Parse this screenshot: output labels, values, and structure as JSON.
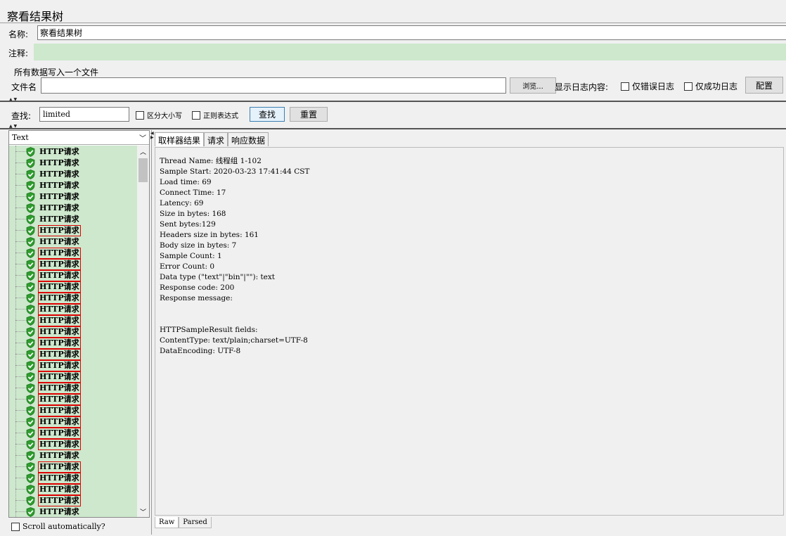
{
  "title": "察看结果树",
  "name": {
    "label": "名称:",
    "value": "察看结果树"
  },
  "comment": {
    "label": "注释:"
  },
  "file": {
    "group_title": "所有数据写入一个文件",
    "label": "文件名",
    "browse_label": "浏览...",
    "log_label": "显示日志内容:",
    "errors_only_label": "仅错误日志",
    "success_only_label": "仅成功日志",
    "config_label": "配置"
  },
  "search": {
    "label": "查找:",
    "value": "limited",
    "case_label": "区分大小写",
    "regex_label": "正则表达式",
    "find_label": "查找",
    "reset_label": "重置"
  },
  "renderer": {
    "selected": "Text"
  },
  "tree": {
    "items": [
      {
        "label": "HTTP请求",
        "highlighted": false
      },
      {
        "label": "HTTP请求",
        "highlighted": false
      },
      {
        "label": "HTTP请求",
        "highlighted": false
      },
      {
        "label": "HTTP请求",
        "highlighted": false
      },
      {
        "label": "HTTP请求",
        "highlighted": false
      },
      {
        "label": "HTTP请求",
        "highlighted": false
      },
      {
        "label": "HTTP请求",
        "highlighted": false
      },
      {
        "label": "HTTP请求",
        "highlighted": true
      },
      {
        "label": "HTTP请求",
        "highlighted": false
      },
      {
        "label": "HTTP请求",
        "highlighted": true
      },
      {
        "label": "HTTP请求",
        "highlighted": true
      },
      {
        "label": "HTTP请求",
        "highlighted": true
      },
      {
        "label": "HTTP请求",
        "highlighted": true
      },
      {
        "label": "HTTP请求",
        "highlighted": true
      },
      {
        "label": "HTTP请求",
        "highlighted": true
      },
      {
        "label": "HTTP请求",
        "highlighted": true
      },
      {
        "label": "HTTP请求",
        "highlighted": true
      },
      {
        "label": "HTTP请求",
        "highlighted": true
      },
      {
        "label": "HTTP请求",
        "highlighted": true
      },
      {
        "label": "HTTP请求",
        "highlighted": true
      },
      {
        "label": "HTTP请求",
        "highlighted": true
      },
      {
        "label": "HTTP请求",
        "highlighted": true
      },
      {
        "label": "HTTP请求",
        "highlighted": true
      },
      {
        "label": "HTTP请求",
        "highlighted": true
      },
      {
        "label": "HTTP请求",
        "highlighted": true
      },
      {
        "label": "HTTP请求",
        "highlighted": true
      },
      {
        "label": "HTTP请求",
        "highlighted": true
      },
      {
        "label": "HTTP请求",
        "highlighted": false
      },
      {
        "label": "HTTP请求",
        "highlighted": true
      },
      {
        "label": "HTTP请求",
        "highlighted": true
      },
      {
        "label": "HTTP请求",
        "highlighted": true
      },
      {
        "label": "HTTP请求",
        "highlighted": true
      },
      {
        "label": "HTTP请求",
        "highlighted": false
      }
    ],
    "status_color": "#2e9d2e",
    "highlight_color": "#dd0000"
  },
  "scroll_auto_label": "Scroll automatically?",
  "tabs": [
    "取样器结果",
    "请求",
    "响应数据"
  ],
  "result_lines": [
    "Thread Name: 线程组 1-102",
    "Sample Start: 2020-03-23 17:41:44 CST",
    "Load time: 69",
    "Connect Time: 17",
    "Latency: 69",
    "Size in bytes: 168",
    "Sent bytes:129",
    "Headers size in bytes: 161",
    "Body size in bytes: 7",
    "Sample Count: 1",
    "Error Count: 0",
    "Data type (\"text\"|\"bin\"|\"\"): text",
    "Response code: 200",
    "Response message: ",
    "",
    "",
    "HTTPSampleResult fields:",
    "ContentType: text/plain;charset=UTF-8",
    "DataEncoding: UTF-8"
  ],
  "bottom_tabs": [
    "Raw",
    "Parsed"
  ]
}
